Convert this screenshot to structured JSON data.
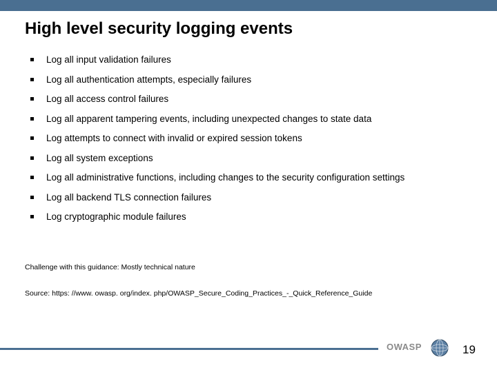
{
  "title": "High level security logging events",
  "bullets": [
    "Log all input validation failures",
    "Log all authentication attempts, especially failures",
    "Log all access control failures",
    "Log all apparent tampering events, including unexpected changes to state data",
    "Log attempts to connect with invalid or expired session tokens",
    "Log all system exceptions",
    "Log all administrative functions, including changes to the security configuration settings",
    "Log all backend TLS connection failures",
    "Log cryptographic module failures"
  ],
  "challenge": "Challenge with this guidance: Mostly technical nature",
  "source": "Source: https: //www. owasp. org/index. php/OWASP_Secure_Coding_Practices_-_Quick_Reference_Guide",
  "brand": "OWASP",
  "page": "19"
}
